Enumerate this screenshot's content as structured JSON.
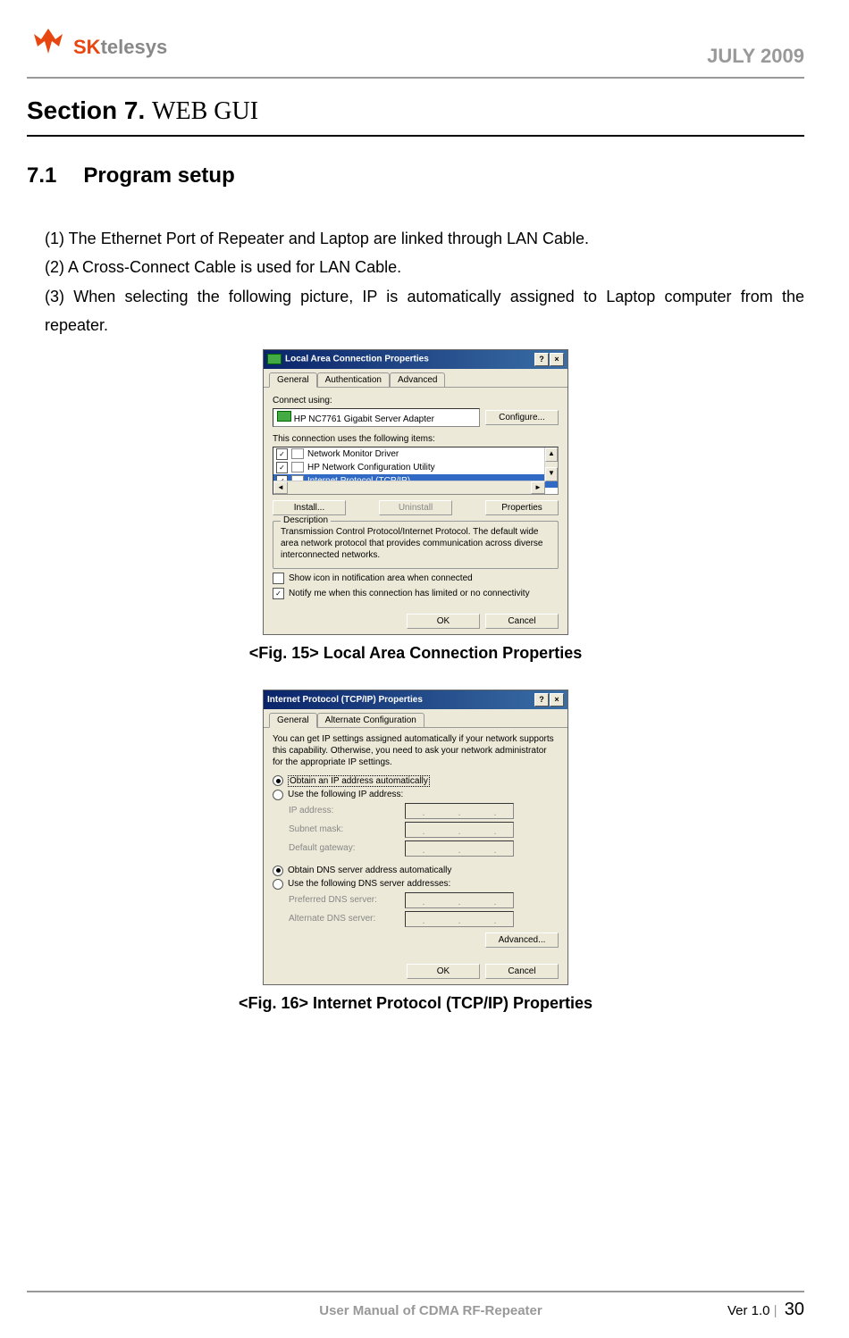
{
  "header": {
    "logo_prefix": "SK",
    "logo_text": "telesys",
    "date": "JULY 2009"
  },
  "section": {
    "prefix": "Section 7.",
    "title": "WEB GUI"
  },
  "subsection": {
    "number": "7.1",
    "title": "Program setup"
  },
  "steps": {
    "s1": "(1) The Ethernet Port of Repeater and Laptop are linked through LAN Cable.",
    "s2": "(2) A Cross-Connect Cable is used for LAN Cable.",
    "s3": "(3) When selecting the following picture, IP is automatically assigned to Laptop computer from the repeater."
  },
  "fig15": {
    "caption": "<Fig. 15> Local Area Connection Properties",
    "title": "Local Area Connection Properties",
    "tabs": {
      "general": "General",
      "auth": "Authentication",
      "advanced": "Advanced"
    },
    "connect_using": "Connect using:",
    "adapter": "HP NC7761 Gigabit Server Adapter",
    "configure": "Configure...",
    "items_label": "This connection uses the following items:",
    "item1": "Network Monitor Driver",
    "item2": "HP Network Configuration Utility",
    "item3": "Internet Protocol (TCP/IP)",
    "install": "Install...",
    "uninstall": "Uninstall",
    "properties": "Properties",
    "desc_label": "Description",
    "desc_text": "Transmission Control Protocol/Internet Protocol. The default wide area network protocol that provides communication across diverse interconnected networks.",
    "show_icon": "Show icon in notification area when connected",
    "notify": "Notify me when this connection has limited or no connectivity",
    "ok": "OK",
    "cancel": "Cancel"
  },
  "fig16": {
    "caption": "<Fig. 16> Internet Protocol (TCP/IP) Properties",
    "title": "Internet Protocol (TCP/IP) Properties",
    "tabs": {
      "general": "General",
      "alt": "Alternate Configuration"
    },
    "intro": "You can get IP settings assigned automatically if your network supports this capability. Otherwise, you need to ask your network administrator for the appropriate IP settings.",
    "opt_auto_ip": "Obtain an IP address automatically",
    "opt_manual_ip": "Use the following IP address:",
    "ip_address": "IP address:",
    "subnet": "Subnet mask:",
    "gateway": "Default gateway:",
    "opt_auto_dns": "Obtain DNS server address automatically",
    "opt_manual_dns": "Use the following DNS server addresses:",
    "pref_dns": "Preferred DNS server:",
    "alt_dns": "Alternate DNS server:",
    "advanced": "Advanced...",
    "ok": "OK",
    "cancel": "Cancel"
  },
  "footer": {
    "manual": "User Manual of CDMA RF-Repeater",
    "version": "Ver 1.0",
    "page": "30"
  }
}
